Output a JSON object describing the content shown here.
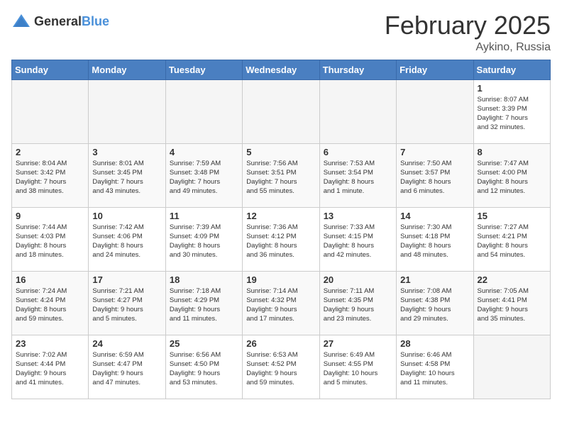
{
  "header": {
    "logo_general": "General",
    "logo_blue": "Blue",
    "month_year": "February 2025",
    "location": "Aykino, Russia"
  },
  "weekdays": [
    "Sunday",
    "Monday",
    "Tuesday",
    "Wednesday",
    "Thursday",
    "Friday",
    "Saturday"
  ],
  "weeks": [
    [
      {
        "day": "",
        "info": ""
      },
      {
        "day": "",
        "info": ""
      },
      {
        "day": "",
        "info": ""
      },
      {
        "day": "",
        "info": ""
      },
      {
        "day": "",
        "info": ""
      },
      {
        "day": "",
        "info": ""
      },
      {
        "day": "1",
        "info": "Sunrise: 8:07 AM\nSunset: 3:39 PM\nDaylight: 7 hours\nand 32 minutes."
      }
    ],
    [
      {
        "day": "2",
        "info": "Sunrise: 8:04 AM\nSunset: 3:42 PM\nDaylight: 7 hours\nand 38 minutes."
      },
      {
        "day": "3",
        "info": "Sunrise: 8:01 AM\nSunset: 3:45 PM\nDaylight: 7 hours\nand 43 minutes."
      },
      {
        "day": "4",
        "info": "Sunrise: 7:59 AM\nSunset: 3:48 PM\nDaylight: 7 hours\nand 49 minutes."
      },
      {
        "day": "5",
        "info": "Sunrise: 7:56 AM\nSunset: 3:51 PM\nDaylight: 7 hours\nand 55 minutes."
      },
      {
        "day": "6",
        "info": "Sunrise: 7:53 AM\nSunset: 3:54 PM\nDaylight: 8 hours\nand 1 minute."
      },
      {
        "day": "7",
        "info": "Sunrise: 7:50 AM\nSunset: 3:57 PM\nDaylight: 8 hours\nand 6 minutes."
      },
      {
        "day": "8",
        "info": "Sunrise: 7:47 AM\nSunset: 4:00 PM\nDaylight: 8 hours\nand 12 minutes."
      }
    ],
    [
      {
        "day": "9",
        "info": "Sunrise: 7:44 AM\nSunset: 4:03 PM\nDaylight: 8 hours\nand 18 minutes."
      },
      {
        "day": "10",
        "info": "Sunrise: 7:42 AM\nSunset: 4:06 PM\nDaylight: 8 hours\nand 24 minutes."
      },
      {
        "day": "11",
        "info": "Sunrise: 7:39 AM\nSunset: 4:09 PM\nDaylight: 8 hours\nand 30 minutes."
      },
      {
        "day": "12",
        "info": "Sunrise: 7:36 AM\nSunset: 4:12 PM\nDaylight: 8 hours\nand 36 minutes."
      },
      {
        "day": "13",
        "info": "Sunrise: 7:33 AM\nSunset: 4:15 PM\nDaylight: 8 hours\nand 42 minutes."
      },
      {
        "day": "14",
        "info": "Sunrise: 7:30 AM\nSunset: 4:18 PM\nDaylight: 8 hours\nand 48 minutes."
      },
      {
        "day": "15",
        "info": "Sunrise: 7:27 AM\nSunset: 4:21 PM\nDaylight: 8 hours\nand 54 minutes."
      }
    ],
    [
      {
        "day": "16",
        "info": "Sunrise: 7:24 AM\nSunset: 4:24 PM\nDaylight: 8 hours\nand 59 minutes."
      },
      {
        "day": "17",
        "info": "Sunrise: 7:21 AM\nSunset: 4:27 PM\nDaylight: 9 hours\nand 5 minutes."
      },
      {
        "day": "18",
        "info": "Sunrise: 7:18 AM\nSunset: 4:29 PM\nDaylight: 9 hours\nand 11 minutes."
      },
      {
        "day": "19",
        "info": "Sunrise: 7:14 AM\nSunset: 4:32 PM\nDaylight: 9 hours\nand 17 minutes."
      },
      {
        "day": "20",
        "info": "Sunrise: 7:11 AM\nSunset: 4:35 PM\nDaylight: 9 hours\nand 23 minutes."
      },
      {
        "day": "21",
        "info": "Sunrise: 7:08 AM\nSunset: 4:38 PM\nDaylight: 9 hours\nand 29 minutes."
      },
      {
        "day": "22",
        "info": "Sunrise: 7:05 AM\nSunset: 4:41 PM\nDaylight: 9 hours\nand 35 minutes."
      }
    ],
    [
      {
        "day": "23",
        "info": "Sunrise: 7:02 AM\nSunset: 4:44 PM\nDaylight: 9 hours\nand 41 minutes."
      },
      {
        "day": "24",
        "info": "Sunrise: 6:59 AM\nSunset: 4:47 PM\nDaylight: 9 hours\nand 47 minutes."
      },
      {
        "day": "25",
        "info": "Sunrise: 6:56 AM\nSunset: 4:50 PM\nDaylight: 9 hours\nand 53 minutes."
      },
      {
        "day": "26",
        "info": "Sunrise: 6:53 AM\nSunset: 4:52 PM\nDaylight: 9 hours\nand 59 minutes."
      },
      {
        "day": "27",
        "info": "Sunrise: 6:49 AM\nSunset: 4:55 PM\nDaylight: 10 hours\nand 5 minutes."
      },
      {
        "day": "28",
        "info": "Sunrise: 6:46 AM\nSunset: 4:58 PM\nDaylight: 10 hours\nand 11 minutes."
      },
      {
        "day": "",
        "info": ""
      }
    ]
  ]
}
